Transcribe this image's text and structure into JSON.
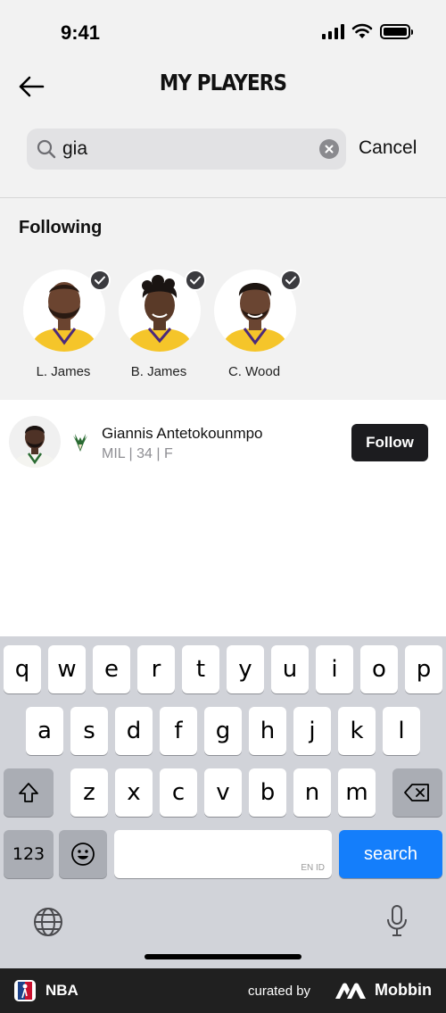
{
  "status_bar": {
    "time": "9:41"
  },
  "header": {
    "title": "MY PLAYERS"
  },
  "search": {
    "value": "gia",
    "cancel_label": "Cancel"
  },
  "following": {
    "title": "Following",
    "players": [
      {
        "name": "L. James"
      },
      {
        "name": "B. James"
      },
      {
        "name": "C. Wood"
      }
    ]
  },
  "results": [
    {
      "name": "Giannis Antetokounmpo",
      "meta": "MIL | 34 | F",
      "button": "Follow"
    }
  ],
  "keyboard": {
    "row1": [
      "q",
      "w",
      "e",
      "r",
      "t",
      "y",
      "u",
      "i",
      "o",
      "p"
    ],
    "row2": [
      "a",
      "s",
      "d",
      "f",
      "g",
      "h",
      "j",
      "k",
      "l"
    ],
    "row3": [
      "z",
      "x",
      "c",
      "v",
      "b",
      "n",
      "m"
    ],
    "numbers_key": "123",
    "space_hint": "EN ID",
    "search_key": "search"
  },
  "footer": {
    "app_name": "NBA",
    "curated_by": "curated by",
    "brand": "Mobbin"
  },
  "colors": {
    "accent_blue": "#147efb",
    "follow_button": "#1c1c1f",
    "jersey_yellow": "#f5c52a",
    "bucks_green": "#2a6b32"
  }
}
